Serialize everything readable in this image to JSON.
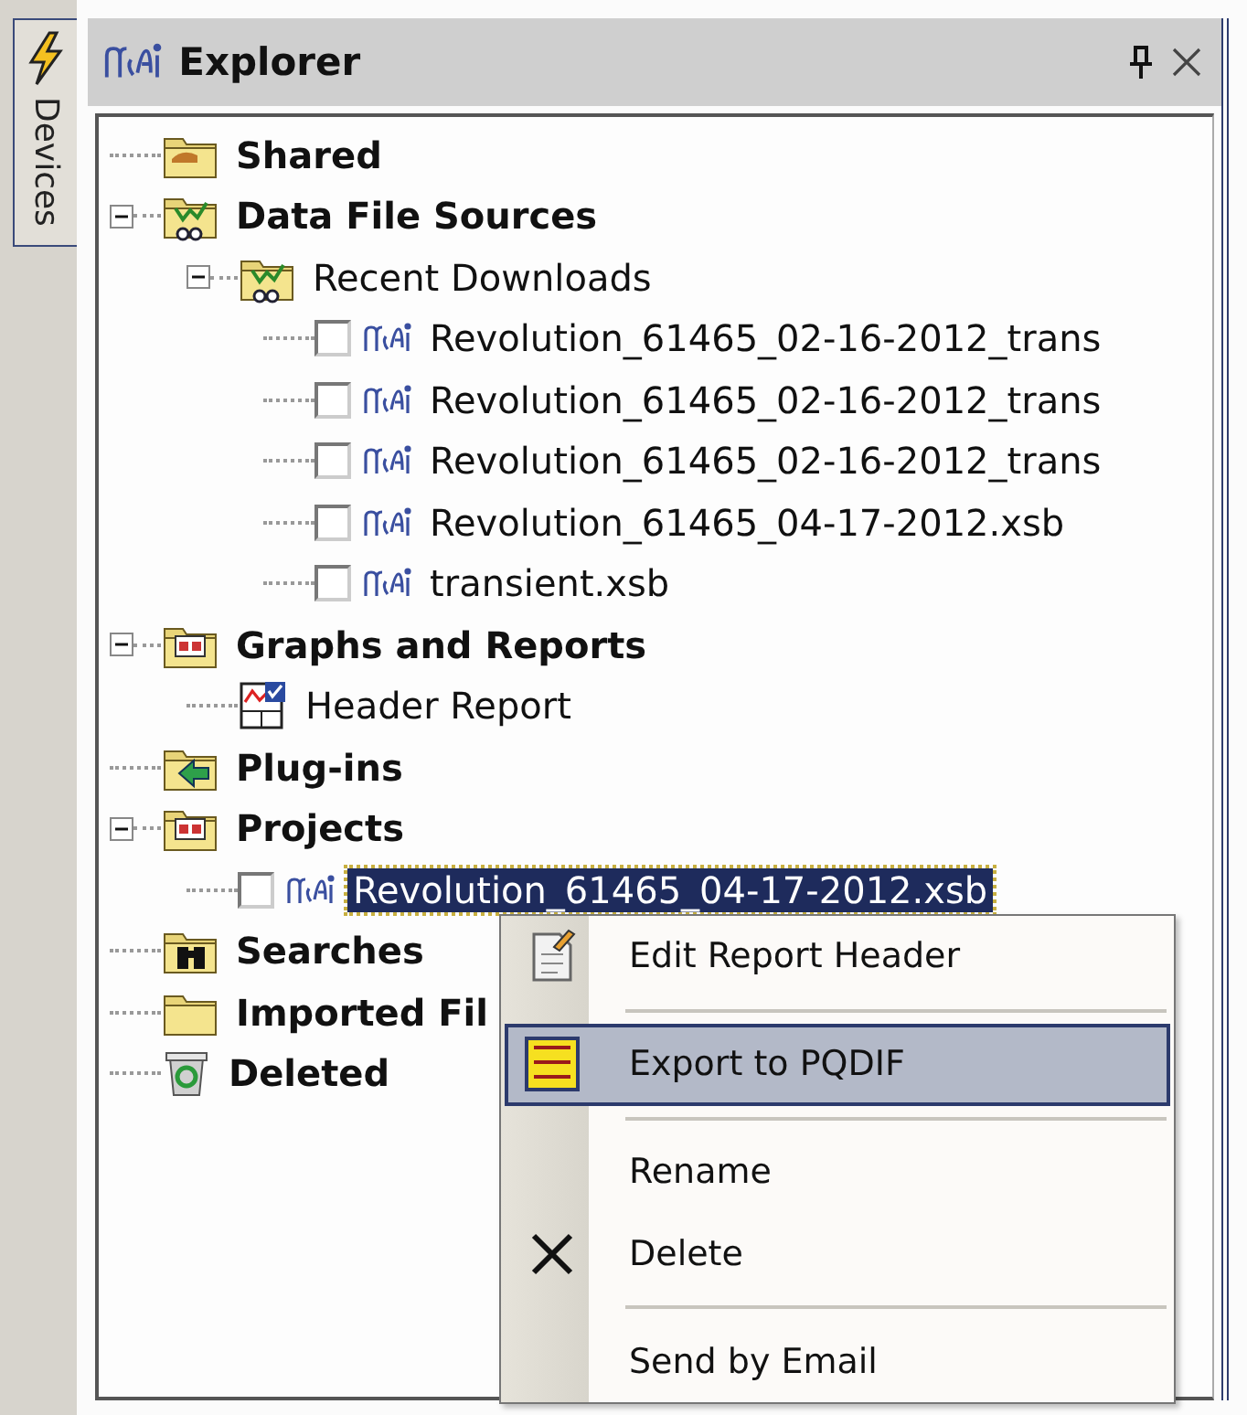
{
  "side_tab": {
    "label": "Devices"
  },
  "panel": {
    "title": "Explorer"
  },
  "tree": [
    {
      "label": "Shared",
      "kind": "shared"
    },
    {
      "label": "Data File Sources",
      "kind": "sources",
      "expanded": true,
      "children": [
        {
          "label": "Recent Downloads",
          "kind": "recent",
          "expanded": true,
          "children": [
            {
              "label": "Revolution_61465_02-16-2012_trans",
              "kind": "file",
              "checked": false,
              "selected": false
            },
            {
              "label": "Revolution_61465_02-16-2012_trans",
              "kind": "file",
              "checked": false,
              "selected": false
            },
            {
              "label": "Revolution_61465_02-16-2012_trans",
              "kind": "file",
              "checked": false,
              "selected": false
            },
            {
              "label": "Revolution_61465_04-17-2012.xsb",
              "kind": "file",
              "checked": false,
              "selected": false
            },
            {
              "label": "transient.xsb",
              "kind": "file",
              "checked": false,
              "selected": false
            }
          ]
        }
      ]
    },
    {
      "label": "Graphs and Reports",
      "kind": "graphs",
      "expanded": true,
      "children": [
        {
          "label": "Header Report",
          "kind": "report"
        }
      ]
    },
    {
      "label": "Plug-ins",
      "kind": "plugins"
    },
    {
      "label": "Projects",
      "kind": "projects",
      "expanded": true,
      "children": [
        {
          "label": "Revolution_61465_04-17-2012.xsb",
          "kind": "file",
          "checked": false,
          "selected": true
        }
      ]
    },
    {
      "label": "Searches",
      "kind": "searches"
    },
    {
      "label": "Imported Fil",
      "kind": "imported"
    },
    {
      "label": "Deleted",
      "kind": "deleted"
    }
  ],
  "context_menu": [
    {
      "kind": "edit",
      "label": "Edit Report Header",
      "selected": false
    },
    {
      "kind": "separator"
    },
    {
      "kind": "export",
      "label": "Export to PQDIF",
      "selected": true
    },
    {
      "kind": "separator"
    },
    {
      "kind": "plain",
      "label": "Rename",
      "selected": false
    },
    {
      "kind": "delete",
      "label": "Delete",
      "selected": false
    },
    {
      "kind": "separator"
    },
    {
      "kind": "plain",
      "label": "Send by Email",
      "selected": false
    }
  ]
}
